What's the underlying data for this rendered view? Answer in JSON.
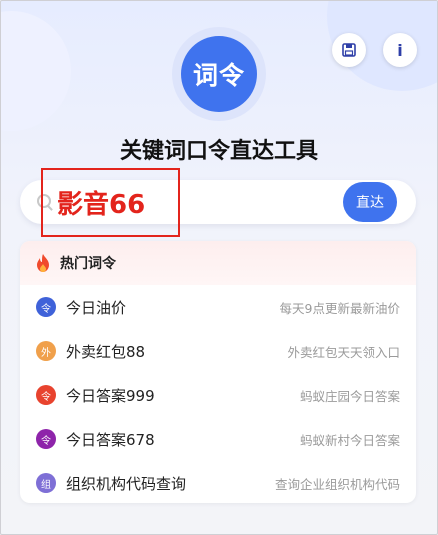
{
  "header": {
    "logo_text": "词令",
    "save_icon": "save-icon",
    "info_label": "i",
    "title": "关键词口令直达工具"
  },
  "search": {
    "value": "",
    "placeholder": "",
    "go_label": "直达"
  },
  "annotation": {
    "text": "影音66",
    "color": "#e3241c"
  },
  "hot": {
    "title": "热门词令",
    "icon": "fire-icon",
    "items": [
      {
        "badge": "令",
        "badge_color": "#3f62d9",
        "title": "今日油价",
        "desc": "每天9点更新最新油价"
      },
      {
        "badge": "外",
        "badge_color": "#f0a04b",
        "title": "外卖红包88",
        "desc": "外卖红包天天领入口"
      },
      {
        "badge": "令",
        "badge_color": "#e8432e",
        "title": "今日答案999",
        "desc": "蚂蚁庄园今日答案"
      },
      {
        "badge": "令",
        "badge_color": "#8e24aa",
        "title": "今日答案678",
        "desc": "蚂蚁新村今日答案"
      },
      {
        "badge": "组",
        "badge_color": "#7e6fd6",
        "title": "组织机构代码查询",
        "desc": "查询企业组织机构代码"
      }
    ]
  },
  "colors": {
    "accent": "#3f73ee",
    "annotation": "#e3241c"
  }
}
